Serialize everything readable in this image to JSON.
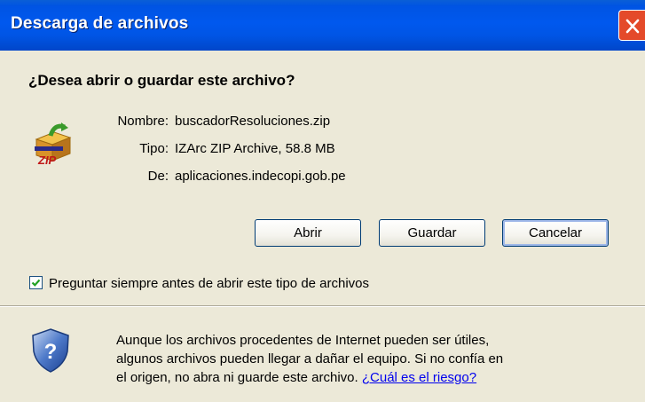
{
  "window": {
    "title": "Descarga de archivos"
  },
  "dialog": {
    "question": "¿Desea abrir o guardar este archivo?",
    "file_icon": "zip-archive-icon",
    "fields": [
      {
        "label": "Nombre:",
        "value": "buscadorResoluciones.zip"
      },
      {
        "label": "Tipo:",
        "value": "IZArc ZIP Archive, 58.8 MB"
      },
      {
        "label": "De:",
        "value": "aplicaciones.indecopi.gob.pe"
      }
    ],
    "buttons": {
      "open": "Abrir",
      "save": "Guardar",
      "cancel": "Cancelar"
    },
    "checkbox": {
      "label": "Preguntar siempre antes de abrir este tipo de archivos",
      "checked": true
    },
    "warning": {
      "icon": "shield-icon",
      "line1": "Aunque los archivos procedentes de Internet pueden ser útiles,",
      "line2": "algunos archivos pueden llegar a dañar el equipo. Si no confía en",
      "line3": "el origen, no abra ni guarde este archivo.",
      "link": "¿Cuál es el riesgo?"
    }
  },
  "colors": {
    "titlebar": "#0055e5",
    "dialog_bg": "#ece9d8",
    "close_button": "#e44a2a",
    "link": "#0000ee"
  }
}
